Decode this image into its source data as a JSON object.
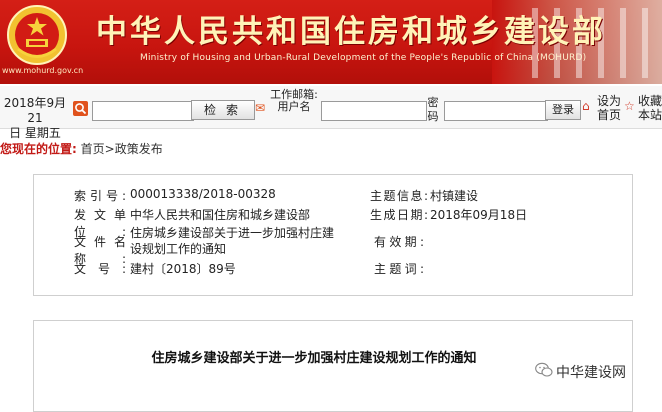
{
  "header": {
    "title": "中华人民共和国住房和城乡建设部",
    "subtitle": "Ministry of Housing and Urban-Rural Development of the People's Republic of China (MOHURD)",
    "url": "www.mohurd.gov.cn",
    "colors": {
      "banner": "#c8150f",
      "title": "#fff3b8"
    }
  },
  "toolbar": {
    "date_line1": "2018年9月21",
    "date_line2": "日 星期五",
    "search_placeholder": "",
    "search_label": "检索",
    "mail_label": "工作邮箱: 用户名",
    "password_label": "密码",
    "login_label": "登录",
    "set_home_label": "设为首页",
    "favorite_label": "收藏本站",
    "icons": [
      "search-icon",
      "mail-icon",
      "home-icon",
      "star-icon"
    ]
  },
  "breadcrumb": {
    "label": "您现在的位置:",
    "path": "首页>政策发布"
  },
  "info": {
    "index_label": "索引号:",
    "index_value": "000013338/2018-00328",
    "topic_label": "主题信息:",
    "topic_value": "村镇建设",
    "issuer_label": "发文单位:",
    "issuer_value": "中华人民共和国住房和城乡建设部",
    "date_label": "生成日期:",
    "date_value": "2018年09月18日",
    "filename_label": "文件名称:",
    "filename_value": "住房城乡建设部关于进一步加强村庄建设规划工作的通知",
    "validity_label": "有效期:",
    "validity_value": "",
    "docno_label": "文号:",
    "docno_value": "建村〔2018〕89号",
    "keywords_label": "主题词:",
    "keywords_value": ""
  },
  "article": {
    "title": "住房城乡建设部关于进一步加强村庄建设规划工作的通知"
  },
  "watermark": {
    "text": "中华建设网"
  }
}
